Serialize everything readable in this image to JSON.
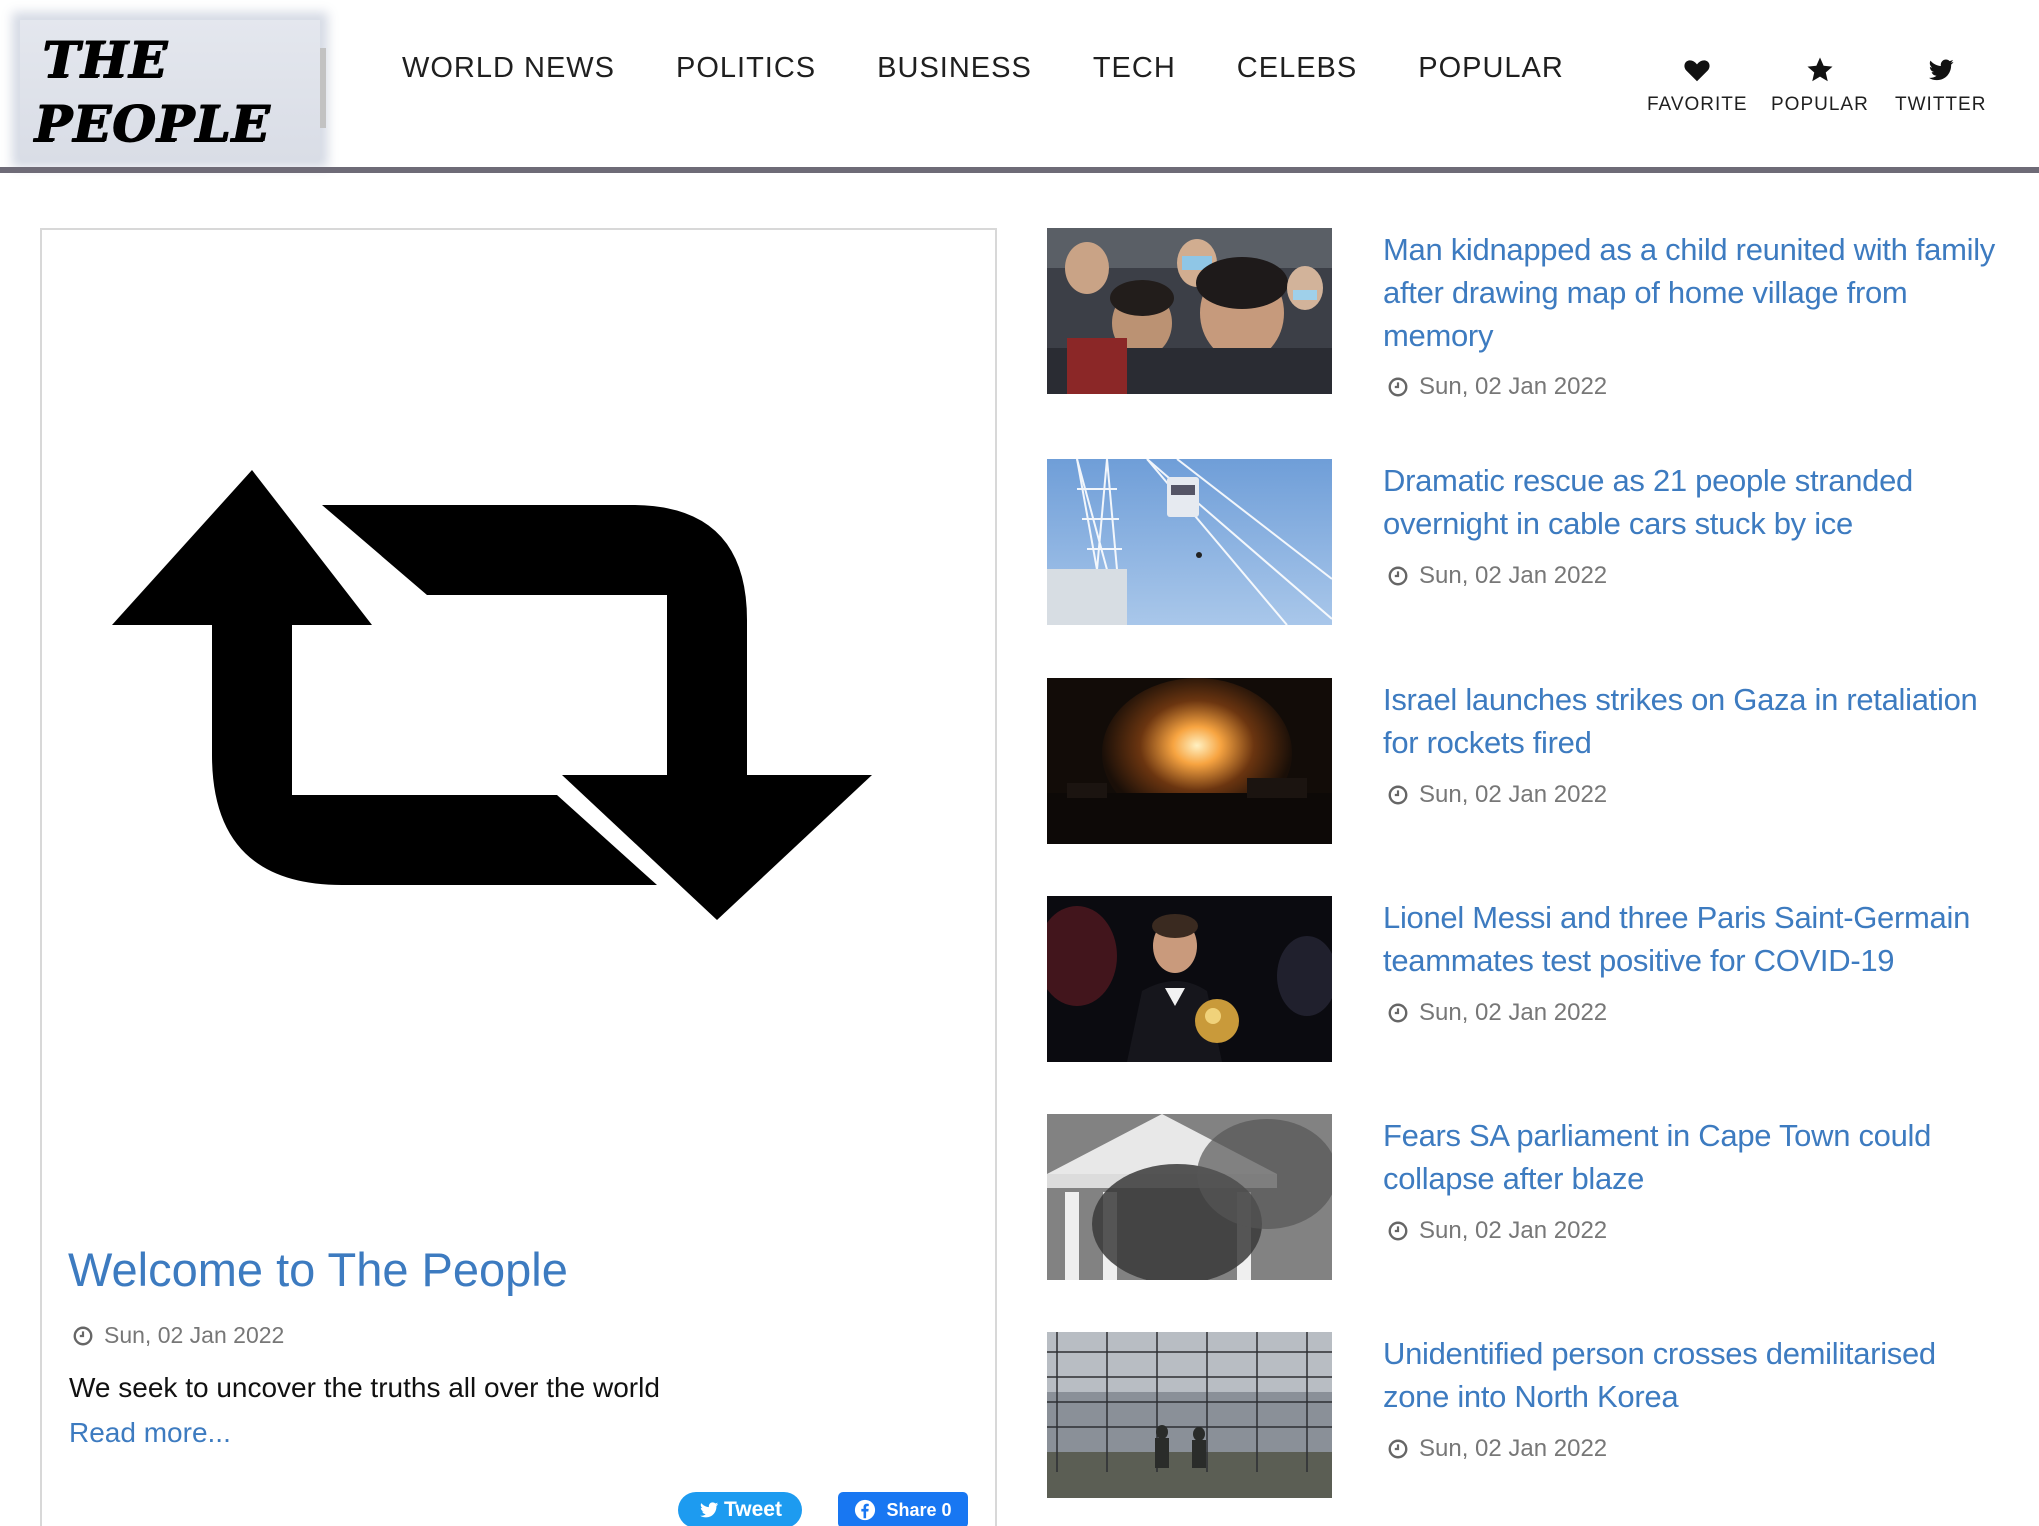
{
  "brand": {
    "line1": "THE",
    "line2": "PEOPLE"
  },
  "nav": [
    "WORLD NEWS",
    "POLITICS",
    "BUSINESS",
    "TECH",
    "CELEBS",
    "POPULAR"
  ],
  "utility": {
    "favorite": "FAVORITE",
    "popular": "POPULAR",
    "twitter": "TWITTER"
  },
  "featured": {
    "title": "Welcome to The People",
    "date": "Sun, 02 Jan 2022",
    "description": "We seek to uncover the truths all over the world",
    "read_more": "Read more...",
    "tweet_label": "Tweet",
    "share_label": "Share 0"
  },
  "stories": [
    {
      "title": "Man kidnapped as a child reunited with family after drawing map of home village from memory",
      "date": "Sun, 02 Jan 2022"
    },
    {
      "title": "Dramatic rescue as 21 people stranded overnight in cable cars stuck by ice",
      "date": "Sun, 02 Jan 2022"
    },
    {
      "title": "Israel launches strikes on Gaza in retaliation for rockets fired",
      "date": "Sun, 02 Jan 2022"
    },
    {
      "title": "Lionel Messi and three Paris Saint-Germain teammates test positive for COVID-19",
      "date": "Sun, 02 Jan 2022"
    },
    {
      "title": "Fears SA parliament in Cape Town could collapse after blaze",
      "date": "Sun, 02 Jan 2022"
    },
    {
      "title": "Unidentified person crosses demilitarised zone into North Korea",
      "date": "Sun, 02 Jan 2022"
    }
  ],
  "colors": {
    "link": "#3d7bc0",
    "header_rule": "#6e6b77",
    "tweet": "#1d9bf0",
    "share": "#1877f2"
  }
}
